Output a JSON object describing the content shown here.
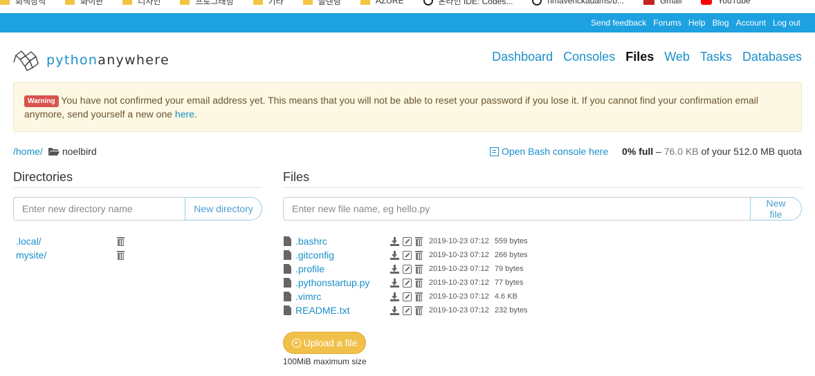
{
  "bookmarks": [
    {
      "label": "회색장직",
      "icon": "folder-icon"
    },
    {
      "label": "화이판",
      "icon": "folder-icon"
    },
    {
      "label": "디자인",
      "icon": "folder-icon"
    },
    {
      "label": "프로그래밍",
      "icon": "folder-icon"
    },
    {
      "label": "기타",
      "icon": "folder-icon"
    },
    {
      "label": "블렌딩",
      "icon": "folder-icon"
    },
    {
      "label": "AZURE",
      "icon": "folder-icon"
    },
    {
      "label": "온라인 IDE: Codes...",
      "icon": "codesandbox-icon"
    },
    {
      "label": "nmaverickadams/b...",
      "icon": "github-icon"
    },
    {
      "label": "Gmail",
      "icon": "gmail-icon"
    },
    {
      "label": "YouTube",
      "icon": "youtube-icon"
    }
  ],
  "topbar": {
    "links": [
      "Send feedback",
      "Forums",
      "Help",
      "Blog",
      "Account",
      "Log out"
    ]
  },
  "header": {
    "logo_prefix": "python",
    "logo_suffix": "anywhere",
    "nav": [
      "Dashboard",
      "Consoles",
      "Files",
      "Web",
      "Tasks",
      "Databases"
    ],
    "active_nav": "Files"
  },
  "warning": {
    "badge": "Warning",
    "text": "You have not confirmed your email address yet. This means that you will not be able to reset your password if you lose it. If you cannot find your confirmation email anymore, send yourself a new one ",
    "link": "here",
    "end": "."
  },
  "breadcrumb": {
    "root": "/home/",
    "current": "noelbird"
  },
  "console_link": "Open Bash console here",
  "quota": {
    "percent": "0% full",
    "dash": " – ",
    "used": "76.0 KB",
    "of": " of your 512.0 MB quota"
  },
  "directories": {
    "title": "Directories",
    "placeholder": "Enter new directory name",
    "button": "New directory",
    "items": [
      ".local/",
      "mysite/"
    ]
  },
  "files": {
    "title": "Files",
    "placeholder": "Enter new file name, eg hello.py",
    "button": "New file",
    "items": [
      {
        "name": ".bashrc",
        "date": "2019-10-23 07:12",
        "size": "559 bytes"
      },
      {
        "name": ".gitconfig",
        "date": "2019-10-23 07:12",
        "size": "266 bytes"
      },
      {
        "name": ".profile",
        "date": "2019-10-23 07:12",
        "size": "79 bytes"
      },
      {
        "name": ".pythonstartup.py",
        "date": "2019-10-23 07:12",
        "size": "77 bytes"
      },
      {
        "name": ".vimrc",
        "date": "2019-10-23 07:12",
        "size": "4.6 KB"
      },
      {
        "name": "README.txt",
        "date": "2019-10-23 07:12",
        "size": "232 bytes"
      }
    ]
  },
  "upload": {
    "button": "Upload a file",
    "note": "100MiB maximum size"
  },
  "colors": {
    "brand_blue": "#1da1e0",
    "link": "#1a8fc9",
    "warning_bg": "#fcf8e3",
    "upload": "#f0c04a"
  }
}
